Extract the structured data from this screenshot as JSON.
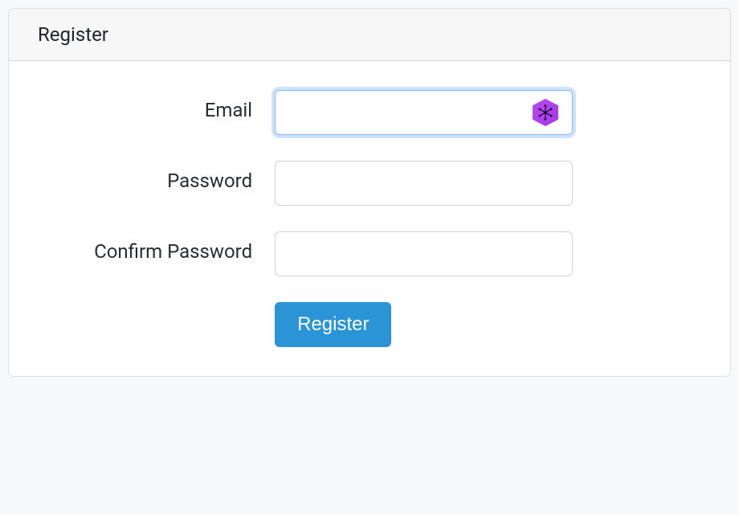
{
  "card": {
    "title": "Register"
  },
  "form": {
    "email_label": "Email",
    "email_value": "",
    "password_label": "Password",
    "password_value": "",
    "confirm_password_label": "Confirm Password",
    "confirm_password_value": "",
    "submit_label": "Register"
  },
  "icons": {
    "password_manager": "password-manager-icon"
  },
  "colors": {
    "primary": "#2a94d6",
    "focus_ring": "rgba(13,110,253,0.2)",
    "border": "#ced4da",
    "text": "#212529"
  }
}
